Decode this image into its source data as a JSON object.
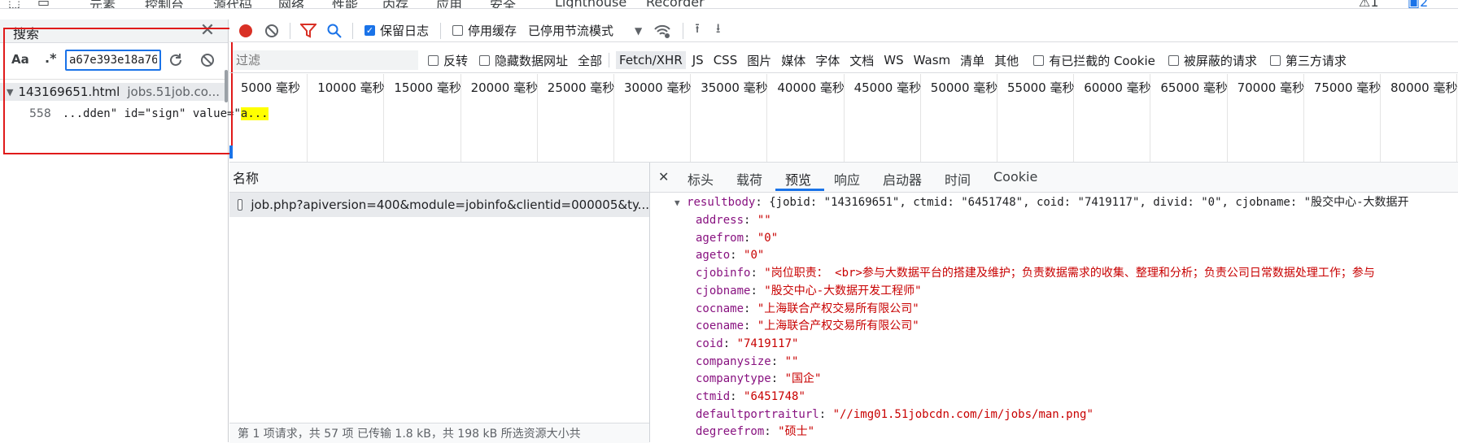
{
  "top_tabs": [
    "元素",
    "控制台",
    "源代码",
    "网络",
    "性能",
    "内存",
    "应用",
    "安全",
    "Lighthouse",
    "Recorder"
  ],
  "top_badges": {
    "warnings": "1",
    "messages": "2"
  },
  "search": {
    "title": "搜索",
    "query": "a67e393e18a76",
    "case_label": "Aa",
    "regex_label": ".*",
    "result_file": "143169651.html",
    "result_domain": "jobs.51job.co...",
    "result_line_no": "558",
    "result_snippet": "...dden\" id=\"sign\" value=\"",
    "result_highlight": "a..."
  },
  "net_toolbar": {
    "preserve_log": "保留日志",
    "disable_cache": "停用缓存",
    "throttle": "已停用节流模式"
  },
  "filter": {
    "placeholder": "过滤",
    "invert": "反转",
    "hide_data_urls": "隐藏数据网址",
    "types": [
      "全部",
      "Fetch/XHR",
      "JS",
      "CSS",
      "图片",
      "媒体",
      "字体",
      "文档",
      "WS",
      "Wasm",
      "清单",
      "其他"
    ],
    "active_type": "Fetch/XHR",
    "blocked_cookies": "有已拦截的 Cookie",
    "blocked_requests": "被屏蔽的请求",
    "third_party": "第三方请求"
  },
  "timeline": {
    "ticks": [
      "5000 毫秒",
      "10000 毫秒",
      "15000 毫秒",
      "20000 毫秒",
      "25000 毫秒",
      "30000 毫秒",
      "35000 毫秒",
      "40000 毫秒",
      "45000 毫秒",
      "50000 毫秒",
      "55000 毫秒",
      "60000 毫秒",
      "65000 毫秒",
      "70000 毫秒",
      "75000 毫秒",
      "80000 毫秒"
    ]
  },
  "requests": {
    "header": "名称",
    "rows": [
      "job.php?apiversion=400&module=jobinfo&clientid=000005&ty..."
    ],
    "status": "第 1 项请求，共 57 项   已传输 1.8 kB，共 198 kB   所选资源大小共"
  },
  "details": {
    "tabs": [
      "标头",
      "载荷",
      "预览",
      "响应",
      "启动器",
      "时间",
      "Cookie"
    ],
    "active_tab": "预览",
    "root_key": "resultbody",
    "root_summary": "{jobid: \"143169651\", ctmid: \"6451748\", coid: \"7419117\", divid: \"0\", cjobname: \"股交中心-大数据开",
    "fields": [
      {
        "key": "address",
        "value": "\"\""
      },
      {
        "key": "agefrom",
        "value": "\"0\""
      },
      {
        "key": "ageto",
        "value": "\"0\""
      },
      {
        "key": "cjobinfo",
        "value": "\"岗位职责： <br>参与大数据平台的搭建及维护；负责数据需求的收集、整理和分析；负责公司日常数据处理工作；参与"
      },
      {
        "key": "cjobname",
        "value": "\"股交中心-大数据开发工程师\""
      },
      {
        "key": "cocname",
        "value": "\"上海联合产权交易所有限公司\""
      },
      {
        "key": "coename",
        "value": "\"上海联合产权交易所有限公司\""
      },
      {
        "key": "coid",
        "value": "\"7419117\""
      },
      {
        "key": "companysize",
        "value": "\"\""
      },
      {
        "key": "companytype",
        "value": "\"国企\""
      },
      {
        "key": "ctmid",
        "value": "\"6451748\""
      },
      {
        "key": "defaultportraiturl",
        "value": "\"//img01.51jobcdn.com/im/jobs/man.png\""
      },
      {
        "key": "degreefrom",
        "value": "\"硕士\""
      }
    ]
  },
  "colors": {
    "accent": "#1a73e8",
    "record": "#d93025",
    "filter_icon": "#d93025",
    "highlight": "#ffff00",
    "annotation_box": "#e01a1a"
  }
}
